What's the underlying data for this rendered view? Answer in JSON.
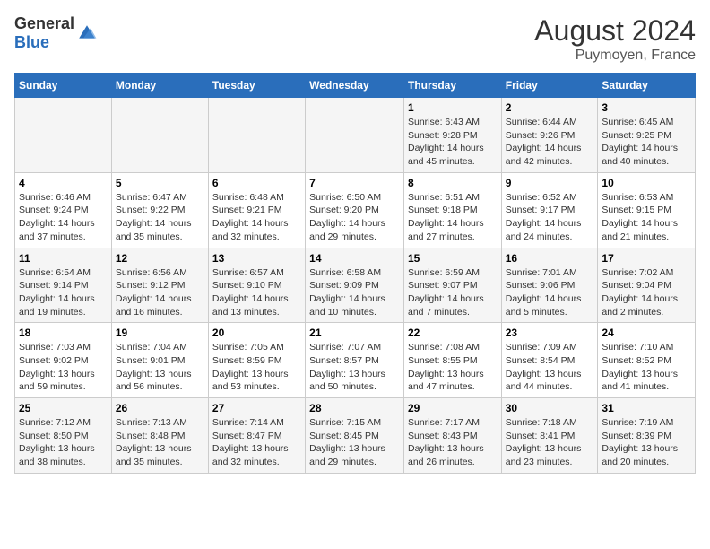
{
  "header": {
    "logo_general": "General",
    "logo_blue": "Blue",
    "title": "August 2024",
    "subtitle": "Puymoyen, France"
  },
  "columns": [
    "Sunday",
    "Monday",
    "Tuesday",
    "Wednesday",
    "Thursday",
    "Friday",
    "Saturday"
  ],
  "weeks": [
    {
      "days": [
        {
          "num": "",
          "info": ""
        },
        {
          "num": "",
          "info": ""
        },
        {
          "num": "",
          "info": ""
        },
        {
          "num": "",
          "info": ""
        },
        {
          "num": "1",
          "info": "Sunrise: 6:43 AM\nSunset: 9:28 PM\nDaylight: 14 hours and 45 minutes."
        },
        {
          "num": "2",
          "info": "Sunrise: 6:44 AM\nSunset: 9:26 PM\nDaylight: 14 hours and 42 minutes."
        },
        {
          "num": "3",
          "info": "Sunrise: 6:45 AM\nSunset: 9:25 PM\nDaylight: 14 hours and 40 minutes."
        }
      ]
    },
    {
      "days": [
        {
          "num": "4",
          "info": "Sunrise: 6:46 AM\nSunset: 9:24 PM\nDaylight: 14 hours and 37 minutes."
        },
        {
          "num": "5",
          "info": "Sunrise: 6:47 AM\nSunset: 9:22 PM\nDaylight: 14 hours and 35 minutes."
        },
        {
          "num": "6",
          "info": "Sunrise: 6:48 AM\nSunset: 9:21 PM\nDaylight: 14 hours and 32 minutes."
        },
        {
          "num": "7",
          "info": "Sunrise: 6:50 AM\nSunset: 9:20 PM\nDaylight: 14 hours and 29 minutes."
        },
        {
          "num": "8",
          "info": "Sunrise: 6:51 AM\nSunset: 9:18 PM\nDaylight: 14 hours and 27 minutes."
        },
        {
          "num": "9",
          "info": "Sunrise: 6:52 AM\nSunset: 9:17 PM\nDaylight: 14 hours and 24 minutes."
        },
        {
          "num": "10",
          "info": "Sunrise: 6:53 AM\nSunset: 9:15 PM\nDaylight: 14 hours and 21 minutes."
        }
      ]
    },
    {
      "days": [
        {
          "num": "11",
          "info": "Sunrise: 6:54 AM\nSunset: 9:14 PM\nDaylight: 14 hours and 19 minutes."
        },
        {
          "num": "12",
          "info": "Sunrise: 6:56 AM\nSunset: 9:12 PM\nDaylight: 14 hours and 16 minutes."
        },
        {
          "num": "13",
          "info": "Sunrise: 6:57 AM\nSunset: 9:10 PM\nDaylight: 14 hours and 13 minutes."
        },
        {
          "num": "14",
          "info": "Sunrise: 6:58 AM\nSunset: 9:09 PM\nDaylight: 14 hours and 10 minutes."
        },
        {
          "num": "15",
          "info": "Sunrise: 6:59 AM\nSunset: 9:07 PM\nDaylight: 14 hours and 7 minutes."
        },
        {
          "num": "16",
          "info": "Sunrise: 7:01 AM\nSunset: 9:06 PM\nDaylight: 14 hours and 5 minutes."
        },
        {
          "num": "17",
          "info": "Sunrise: 7:02 AM\nSunset: 9:04 PM\nDaylight: 14 hours and 2 minutes."
        }
      ]
    },
    {
      "days": [
        {
          "num": "18",
          "info": "Sunrise: 7:03 AM\nSunset: 9:02 PM\nDaylight: 13 hours and 59 minutes."
        },
        {
          "num": "19",
          "info": "Sunrise: 7:04 AM\nSunset: 9:01 PM\nDaylight: 13 hours and 56 minutes."
        },
        {
          "num": "20",
          "info": "Sunrise: 7:05 AM\nSunset: 8:59 PM\nDaylight: 13 hours and 53 minutes."
        },
        {
          "num": "21",
          "info": "Sunrise: 7:07 AM\nSunset: 8:57 PM\nDaylight: 13 hours and 50 minutes."
        },
        {
          "num": "22",
          "info": "Sunrise: 7:08 AM\nSunset: 8:55 PM\nDaylight: 13 hours and 47 minutes."
        },
        {
          "num": "23",
          "info": "Sunrise: 7:09 AM\nSunset: 8:54 PM\nDaylight: 13 hours and 44 minutes."
        },
        {
          "num": "24",
          "info": "Sunrise: 7:10 AM\nSunset: 8:52 PM\nDaylight: 13 hours and 41 minutes."
        }
      ]
    },
    {
      "days": [
        {
          "num": "25",
          "info": "Sunrise: 7:12 AM\nSunset: 8:50 PM\nDaylight: 13 hours and 38 minutes."
        },
        {
          "num": "26",
          "info": "Sunrise: 7:13 AM\nSunset: 8:48 PM\nDaylight: 13 hours and 35 minutes."
        },
        {
          "num": "27",
          "info": "Sunrise: 7:14 AM\nSunset: 8:47 PM\nDaylight: 13 hours and 32 minutes."
        },
        {
          "num": "28",
          "info": "Sunrise: 7:15 AM\nSunset: 8:45 PM\nDaylight: 13 hours and 29 minutes."
        },
        {
          "num": "29",
          "info": "Sunrise: 7:17 AM\nSunset: 8:43 PM\nDaylight: 13 hours and 26 minutes."
        },
        {
          "num": "30",
          "info": "Sunrise: 7:18 AM\nSunset: 8:41 PM\nDaylight: 13 hours and 23 minutes."
        },
        {
          "num": "31",
          "info": "Sunrise: 7:19 AM\nSunset: 8:39 PM\nDaylight: 13 hours and 20 minutes."
        }
      ]
    }
  ]
}
